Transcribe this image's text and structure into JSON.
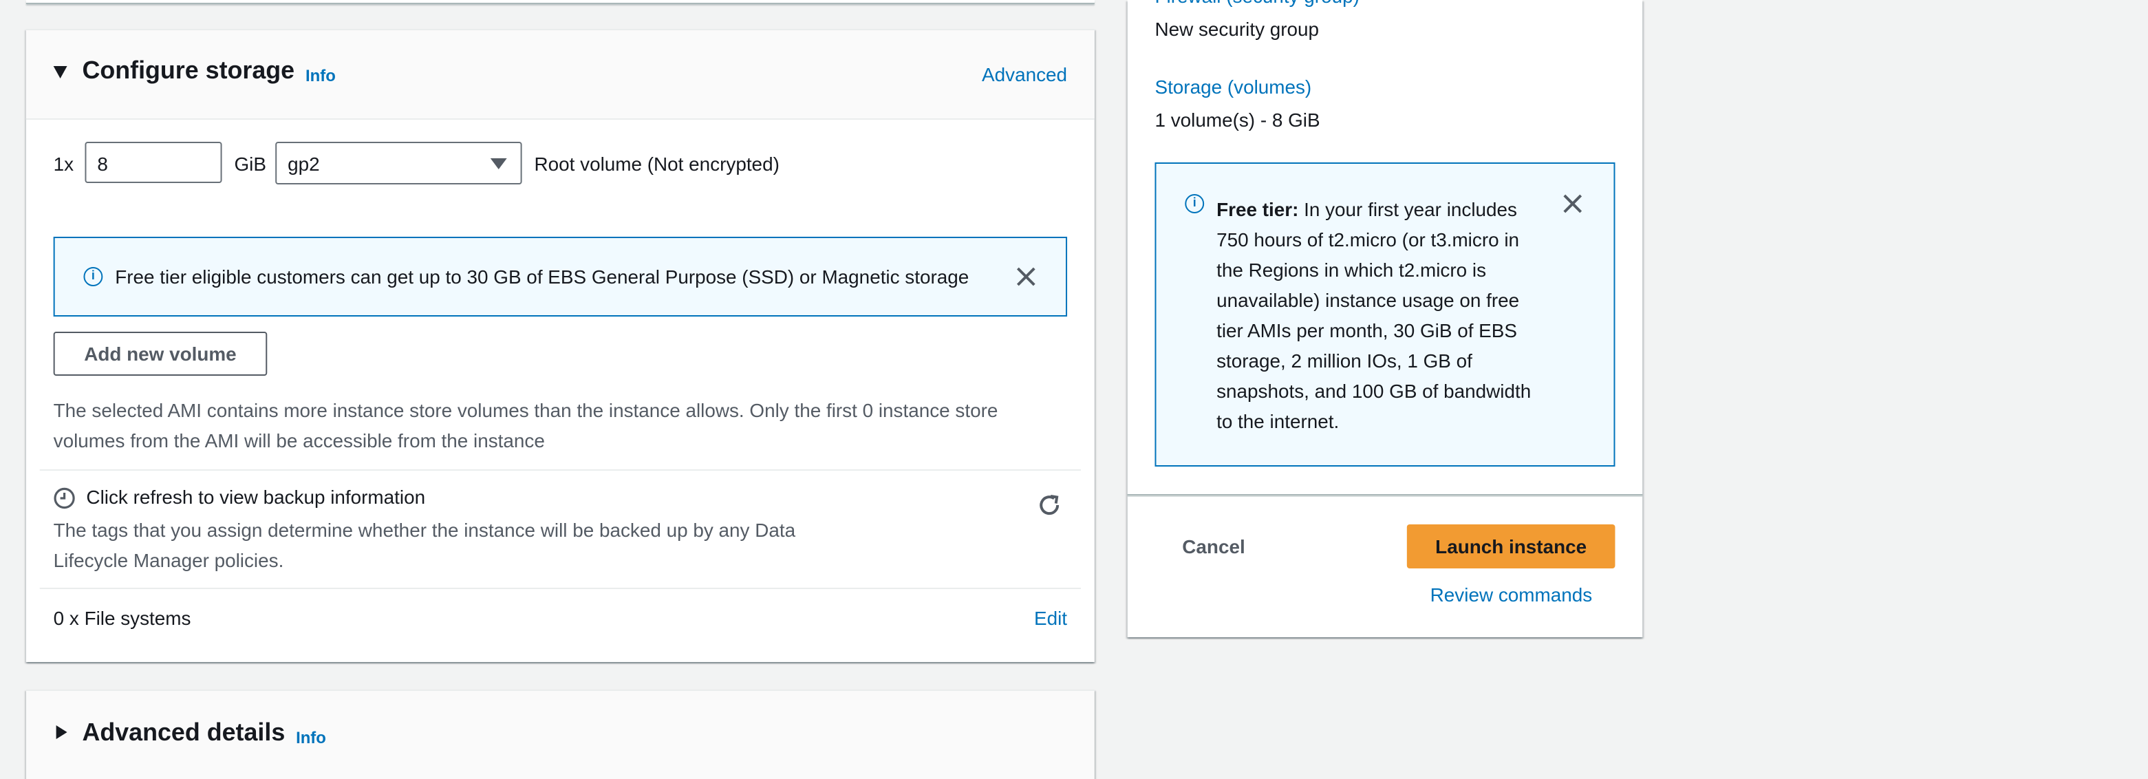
{
  "storage": {
    "title": "Configure storage",
    "info": "Info",
    "advanced": "Advanced",
    "volume": {
      "multiplier": "1x",
      "size": "8",
      "unit": "GiB",
      "type": "gp2",
      "description": "Root volume  (Not encrypted)"
    },
    "free_tier_alert": "Free tier eligible customers can get up to 30 GB of EBS General Purpose (SSD) or Magnetic storage",
    "add_volume": "Add new volume",
    "ami_note": "The selected AMI contains more instance store volumes than the instance allows. Only the first 0 instance store volumes from the AMI will be accessible from the instance",
    "backup": {
      "title": "Click refresh to view backup information",
      "description": "The tags that you assign determine whether the instance will be backed up by any Data Lifecycle Manager policies."
    },
    "file_systems": {
      "label": "0 x File systems",
      "edit": "Edit"
    }
  },
  "advanced_details": {
    "title": "Advanced details",
    "info": "Info"
  },
  "summary": {
    "firewall_label": "Firewall (security group)",
    "firewall_value": "New security group",
    "storage_label": "Storage (volumes)",
    "storage_value": "1 volume(s) - 8 GiB",
    "free_tier": {
      "heading": "Free tier:",
      "body": " In your first year includes 750 hours of t2.micro (or t3.micro in the Regions in which t2.micro is unavailable) instance usage on free tier AMIs per month, 30 GiB of EBS storage, 2 million IOs, 1 GB of snapshots, and 100 GB of bandwidth to the internet."
    },
    "cancel": "Cancel",
    "launch": "Launch instance",
    "review": "Review commands"
  },
  "colors": {
    "link": "#0073bb",
    "primary_button": "#f29b32",
    "alert_background": "#f1faff"
  }
}
